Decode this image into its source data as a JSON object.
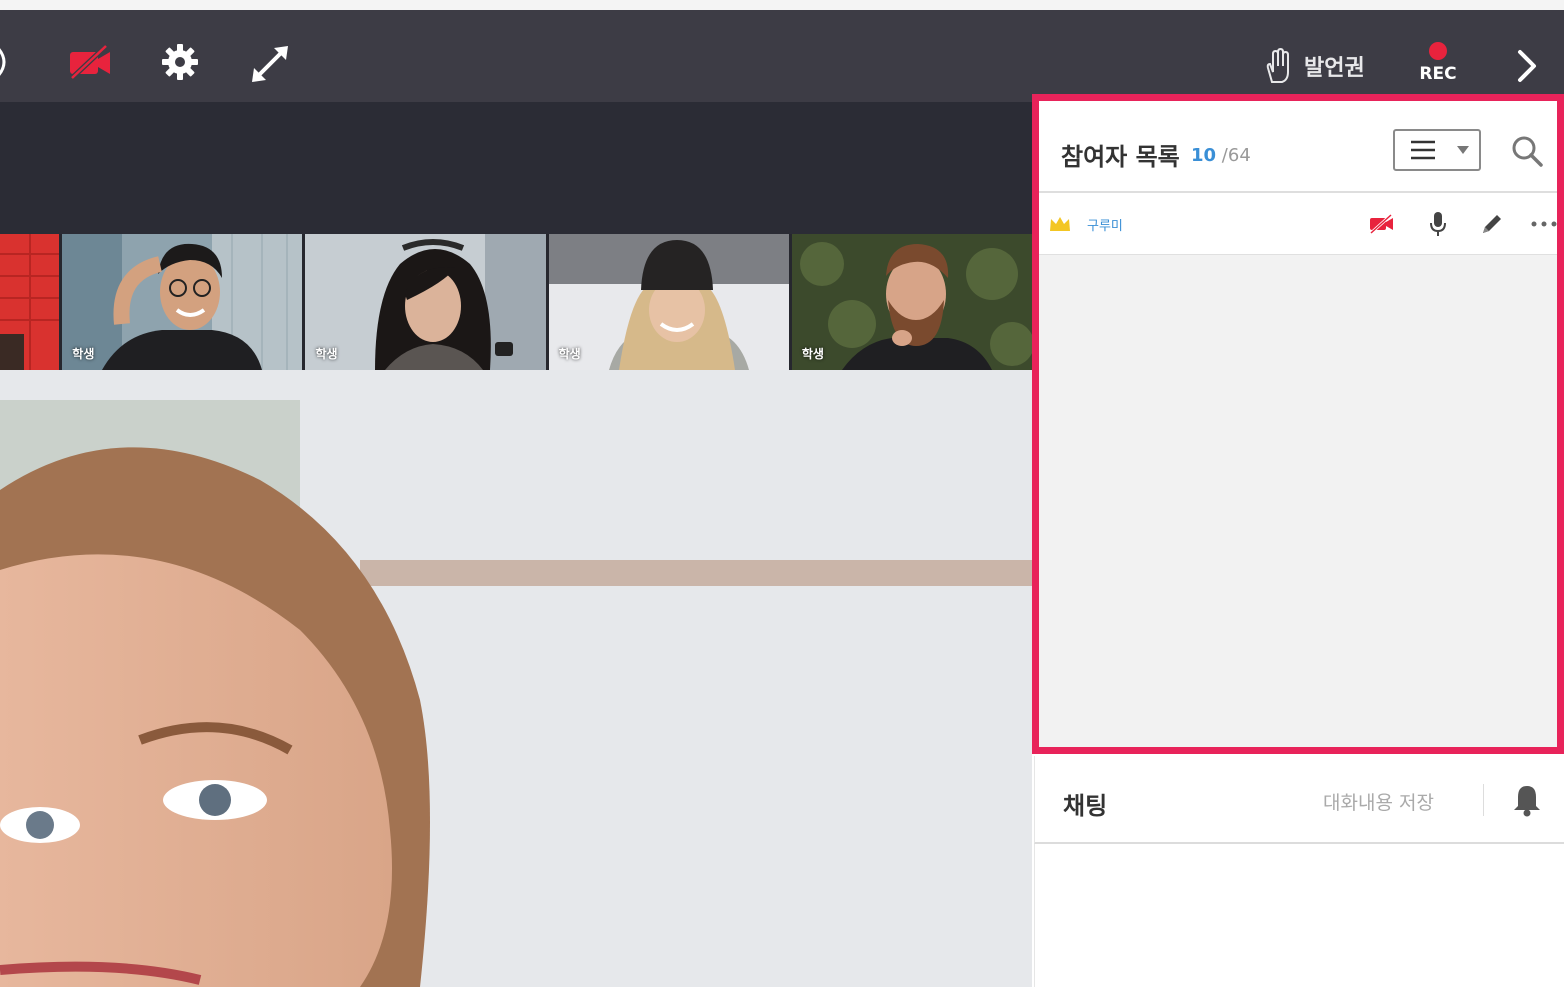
{
  "toolbar": {
    "speak_label": "발언권",
    "rec_label": "REC",
    "icons": [
      "sound-icon",
      "camera-off-icon",
      "gear-icon",
      "expand-icon",
      "hand-raise-icon",
      "record-icon",
      "chevron-right-icon"
    ]
  },
  "thumbnails": [
    {
      "caption": ""
    },
    {
      "caption": "학생"
    },
    {
      "caption": "학생"
    },
    {
      "caption": "학생"
    },
    {
      "caption": "학생"
    }
  ],
  "participants": {
    "title": "참여자 목록",
    "count_current": "10",
    "count_total": "/64",
    "rows": [
      {
        "name": "구루미",
        "icons": [
          "crown-icon",
          "camera-off-icon",
          "microphone-icon",
          "pencil-icon",
          "more-icon"
        ]
      }
    ]
  },
  "chat": {
    "title": "채팅",
    "save_label": "대화내용 저장"
  },
  "colors": {
    "toolbar_bg": "#3d3c45",
    "highlight_border": "#e8235a",
    "accent_blue": "#3a8fd6",
    "rec_red": "#e8233d"
  }
}
